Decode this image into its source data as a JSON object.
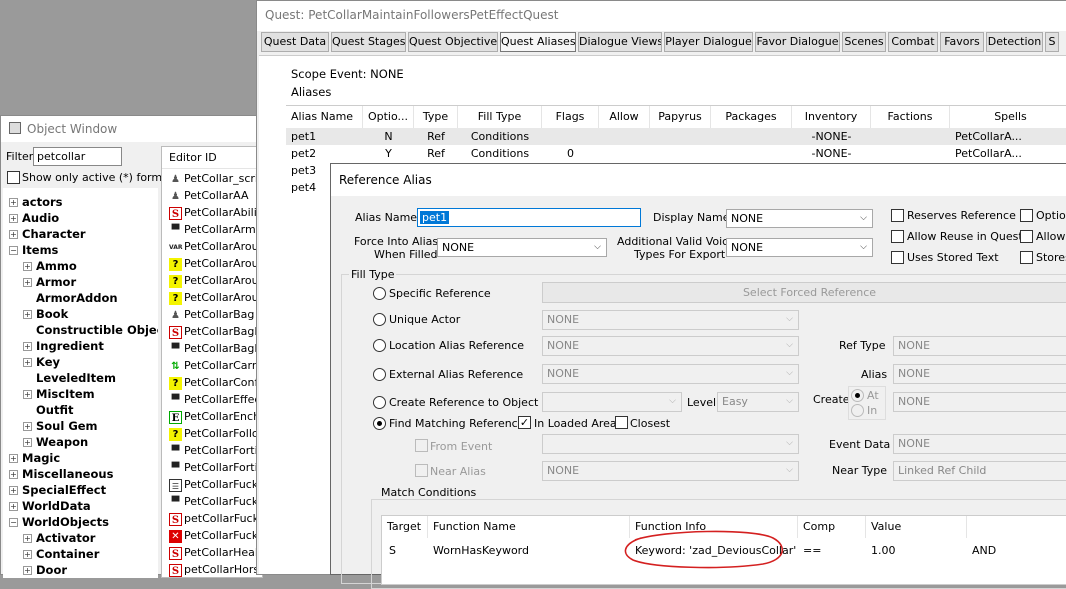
{
  "object_window": {
    "title": "Object Window",
    "filter_label": "Filter",
    "filter_value": "petcollar",
    "show_active_label": "Show only active (*) forms",
    "editor_id_header": "Editor ID",
    "tree": [
      {
        "label": "actors",
        "level": 0,
        "pm": "+"
      },
      {
        "label": "Audio",
        "level": 0,
        "pm": "+"
      },
      {
        "label": "Character",
        "level": 0,
        "pm": "+"
      },
      {
        "label": "Items",
        "level": 0,
        "pm": "-"
      },
      {
        "label": "Ammo",
        "level": 1,
        "pm": "+"
      },
      {
        "label": "Armor",
        "level": 1,
        "pm": "+"
      },
      {
        "label": "ArmorAddon",
        "level": 1,
        "pm": ""
      },
      {
        "label": "Book",
        "level": 1,
        "pm": "+"
      },
      {
        "label": "Constructible Object",
        "level": 1,
        "pm": ""
      },
      {
        "label": "Ingredient",
        "level": 1,
        "pm": "+"
      },
      {
        "label": "Key",
        "level": 1,
        "pm": "+"
      },
      {
        "label": "LeveledItem",
        "level": 1,
        "pm": ""
      },
      {
        "label": "MiscItem",
        "level": 1,
        "pm": "+"
      },
      {
        "label": "Outfit",
        "level": 1,
        "pm": ""
      },
      {
        "label": "Soul Gem",
        "level": 1,
        "pm": "+"
      },
      {
        "label": "Weapon",
        "level": 1,
        "pm": "+"
      },
      {
        "label": "Magic",
        "level": 0,
        "pm": "+"
      },
      {
        "label": "Miscellaneous",
        "level": 0,
        "pm": "+"
      },
      {
        "label": "SpecialEffect",
        "level": 0,
        "pm": "+"
      },
      {
        "label": "WorldData",
        "level": 0,
        "pm": "+"
      },
      {
        "label": "WorldObjects",
        "level": 0,
        "pm": "-"
      },
      {
        "label": "Activator",
        "level": 1,
        "pm": "+"
      },
      {
        "label": "Container",
        "level": 1,
        "pm": "+"
      },
      {
        "label": "Door",
        "level": 1,
        "pm": "+"
      }
    ],
    "items": [
      {
        "label": "PetCollar_script",
        "icon": "person-icon"
      },
      {
        "label": "PetCollarAA",
        "icon": "person-icon"
      },
      {
        "label": "PetCollarAbility",
        "icon": "spell-icon"
      },
      {
        "label": "PetCollarArmorF",
        "icon": "armor-icon"
      },
      {
        "label": "PetCollarArousal",
        "icon": "variable-icon"
      },
      {
        "label": "PetCollarArouse",
        "icon": "quest-icon"
      },
      {
        "label": "PetCollarArouse",
        "icon": "quest-icon"
      },
      {
        "label": "PetCollarArouse",
        "icon": "quest-icon"
      },
      {
        "label": "PetCollarBag",
        "icon": "person-icon"
      },
      {
        "label": "PetCollarBagHo",
        "icon": "spell-icon"
      },
      {
        "label": "PetCollarBagRe",
        "icon": "armor-icon"
      },
      {
        "label": "PetCollarCarryW",
        "icon": "arrows-icon"
      },
      {
        "label": "PetCollarConfig",
        "icon": "quest-icon"
      },
      {
        "label": "PetCollarEffect",
        "icon": "armor-icon"
      },
      {
        "label": "PetCollarEnch",
        "icon": "enchant-icon"
      },
      {
        "label": "PetCollarFollow",
        "icon": "quest-icon"
      },
      {
        "label": "PetCollarFortify",
        "icon": "armor-icon"
      },
      {
        "label": "PetCollarFortify",
        "icon": "armor-icon"
      },
      {
        "label": "PetCollarFuckF",
        "icon": "list-icon"
      },
      {
        "label": "PetCollarFuckto",
        "icon": "armor-icon"
      },
      {
        "label": "petCollarFuckto",
        "icon": "spell-icon"
      },
      {
        "label": "PetCollarFuckto",
        "icon": "red-x-icon"
      },
      {
        "label": "PetCollarHealth",
        "icon": "spell-icon"
      },
      {
        "label": "petCollarHorsef",
        "icon": "spell-icon"
      }
    ]
  },
  "quest_window": {
    "title": "Quest: PetCollarMaintainFollowersPetEffectQuest",
    "tabs": [
      "Quest Data",
      "Quest Stages",
      "Quest Objectives",
      "Quest Aliases",
      "Dialogue Views",
      "Player Dialogue",
      "Favor Dialogue",
      "Scenes",
      "Combat",
      "Favors",
      "Detection",
      "S"
    ],
    "active_tab": "Quest Aliases",
    "scope_event": "Scope Event: NONE",
    "aliases_label": "Aliases",
    "columns": [
      "Alias Name",
      "Optio...",
      "Type",
      "Fill Type",
      "Flags",
      "Allow",
      "Papyrus",
      "Packages",
      "Inventory",
      "Factions",
      "Spells"
    ],
    "rows": [
      [
        "pet1",
        "N",
        "Ref",
        "Conditions",
        "",
        "",
        "",
        "",
        "-NONE-",
        "",
        "PetCollarA..."
      ],
      [
        "pet2",
        "Y",
        "Ref",
        "Conditions",
        "0",
        "",
        "",
        "",
        "-NONE-",
        "",
        "PetCollarA..."
      ],
      [
        "pet3",
        "",
        "",
        "",
        "",
        "",
        "",
        "",
        "",
        "",
        ""
      ],
      [
        "pet4",
        "",
        "",
        "",
        "",
        "",
        "",
        "",
        "",
        "",
        ""
      ]
    ]
  },
  "ref_alias": {
    "title": "Reference Alias",
    "alias_name_label": "Alias Name",
    "alias_name_value": "pet1",
    "display_name_label": "Display Name",
    "display_name_value": "NONE",
    "force_label_1": "Force Into Alias",
    "force_label_2": "When Filled",
    "force_value": "NONE",
    "voice_label_1": "Additional Valid Voice",
    "voice_label_2": "Types For Export",
    "voice_value": "NONE",
    "checks": [
      "Reserves Reference",
      "Allow Reuse in Quest",
      "Uses Stored Text",
      "Option",
      "Allow D",
      "Stores"
    ],
    "fill_type_label": "Fill Type",
    "specific_ref_label": "Specific Reference",
    "select_forced_label": "Select Forced Reference",
    "unique_actor_label": "Unique Actor",
    "location_alias_label": "Location Alias Reference",
    "external_alias_label": "External Alias Reference",
    "create_ref_label": "Create Reference to Object",
    "find_matching_label": "Find Matching Reference",
    "in_loaded_area_label": "In Loaded Area",
    "closest_label": "Closest",
    "from_event_label": "From Event",
    "near_alias_label": "Near Alias",
    "none": "NONE",
    "level_label": "Level",
    "level_value": "Easy",
    "create_label": "Create",
    "at_label": "At",
    "in_label": "In",
    "ref_type_label": "Ref Type",
    "alias_label": "Alias",
    "event_data_label": "Event Data",
    "near_type_label": "Near Type",
    "near_type_value": "Linked Ref Child",
    "match_conditions_label": "Match Conditions",
    "cond_columns": [
      "Target",
      "Function Name",
      "Function Info",
      "Comp",
      "Value",
      ""
    ],
    "cond_rows": [
      [
        "S",
        "WornHasKeyword",
        "Keyword: 'zad_DeviousCollar'",
        "==",
        "1.00",
        "AND"
      ]
    ]
  },
  "colors": {
    "highlight_circle": "#d42020",
    "selection": "#0078d7"
  }
}
